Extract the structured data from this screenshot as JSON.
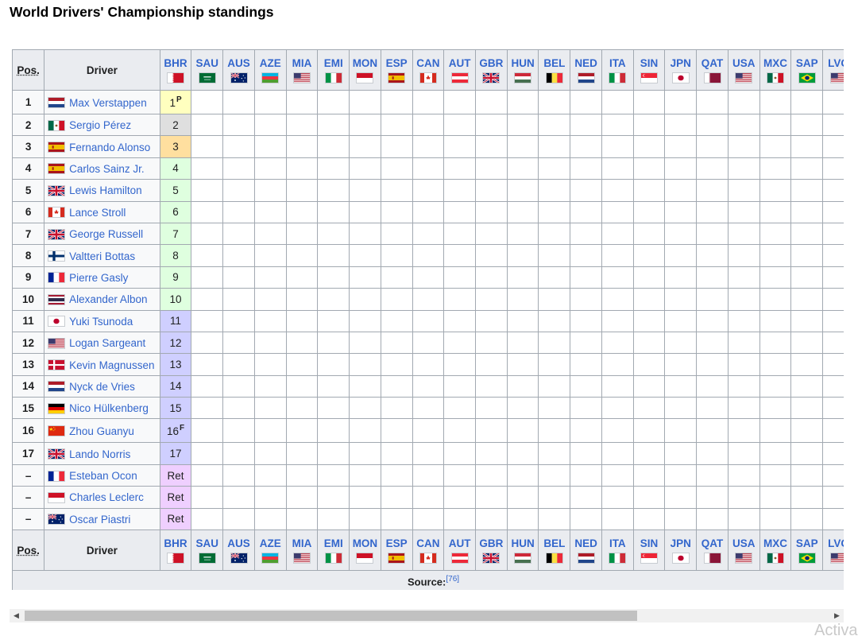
{
  "title": "World Drivers' Championship standings",
  "header": {
    "pos": "Pos.",
    "driver": "Driver"
  },
  "races": [
    {
      "code": "BHR",
      "flag": "bahrain"
    },
    {
      "code": "SAU",
      "flag": "saudi"
    },
    {
      "code": "AUS",
      "flag": "australia"
    },
    {
      "code": "AZE",
      "flag": "azerbaijan"
    },
    {
      "code": "MIA",
      "flag": "usa"
    },
    {
      "code": "EMI",
      "flag": "italy"
    },
    {
      "code": "MON",
      "flag": "monaco"
    },
    {
      "code": "ESP",
      "flag": "spain"
    },
    {
      "code": "CAN",
      "flag": "canada"
    },
    {
      "code": "AUT",
      "flag": "austria"
    },
    {
      "code": "GBR",
      "flag": "uk"
    },
    {
      "code": "HUN",
      "flag": "hungary"
    },
    {
      "code": "BEL",
      "flag": "belgium"
    },
    {
      "code": "NED",
      "flag": "netherlands"
    },
    {
      "code": "ITA",
      "flag": "italy"
    },
    {
      "code": "SIN",
      "flag": "singapore"
    },
    {
      "code": "JPN",
      "flag": "japan"
    },
    {
      "code": "QAT",
      "flag": "qatar"
    },
    {
      "code": "USA",
      "flag": "usa"
    },
    {
      "code": "MXC",
      "flag": "mexico"
    },
    {
      "code": "SAP",
      "flag": "brazil"
    },
    {
      "code": "LVG",
      "flag": "usa"
    }
  ],
  "rows": [
    {
      "pos": "1",
      "driver": "Max Verstappen",
      "flag": "netherlands",
      "result": "1",
      "sup": "P",
      "cls": "c-gold"
    },
    {
      "pos": "2",
      "driver": "Sergio Pérez",
      "flag": "mexico",
      "result": "2",
      "sup": "",
      "cls": "c-silver"
    },
    {
      "pos": "3",
      "driver": "Fernando Alonso",
      "flag": "spain",
      "result": "3",
      "sup": "",
      "cls": "c-bronze"
    },
    {
      "pos": "4",
      "driver": "Carlos Sainz Jr.",
      "flag": "spain",
      "result": "4",
      "sup": "",
      "cls": "c-green"
    },
    {
      "pos": "5",
      "driver": "Lewis Hamilton",
      "flag": "uk",
      "result": "5",
      "sup": "",
      "cls": "c-green"
    },
    {
      "pos": "6",
      "driver": "Lance Stroll",
      "flag": "canada",
      "result": "6",
      "sup": "",
      "cls": "c-green"
    },
    {
      "pos": "7",
      "driver": "George Russell",
      "flag": "uk",
      "result": "7",
      "sup": "",
      "cls": "c-green"
    },
    {
      "pos": "8",
      "driver": "Valtteri Bottas",
      "flag": "finland",
      "result": "8",
      "sup": "",
      "cls": "c-green"
    },
    {
      "pos": "9",
      "driver": "Pierre Gasly",
      "flag": "france",
      "result": "9",
      "sup": "",
      "cls": "c-green"
    },
    {
      "pos": "10",
      "driver": "Alexander Albon",
      "flag": "thailand",
      "result": "10",
      "sup": "",
      "cls": "c-green"
    },
    {
      "pos": "11",
      "driver": "Yuki Tsunoda",
      "flag": "japan",
      "result": "11",
      "sup": "",
      "cls": "c-blue"
    },
    {
      "pos": "12",
      "driver": "Logan Sargeant",
      "flag": "usa",
      "result": "12",
      "sup": "",
      "cls": "c-blue"
    },
    {
      "pos": "13",
      "driver": "Kevin Magnussen",
      "flag": "denmark",
      "result": "13",
      "sup": "",
      "cls": "c-blue"
    },
    {
      "pos": "14",
      "driver": "Nyck de Vries",
      "flag": "netherlands",
      "result": "14",
      "sup": "",
      "cls": "c-blue"
    },
    {
      "pos": "15",
      "driver": "Nico Hülkenberg",
      "flag": "germany",
      "result": "15",
      "sup": "",
      "cls": "c-blue"
    },
    {
      "pos": "16",
      "driver": "Zhou Guanyu",
      "flag": "china",
      "result": "16",
      "sup": "F",
      "cls": "c-blue"
    },
    {
      "pos": "17",
      "driver": "Lando Norris",
      "flag": "uk",
      "result": "17",
      "sup": "",
      "cls": "c-blue"
    },
    {
      "pos": "–",
      "driver": "Esteban Ocon",
      "flag": "france",
      "result": "Ret",
      "sup": "",
      "cls": "c-ret"
    },
    {
      "pos": "–",
      "driver": "Charles Leclerc",
      "flag": "monaco",
      "result": "Ret",
      "sup": "",
      "cls": "c-ret"
    },
    {
      "pos": "–",
      "driver": "Oscar Piastri",
      "flag": "australia",
      "result": "Ret",
      "sup": "",
      "cls": "c-ret"
    }
  ],
  "source": {
    "label": "Source:",
    "ref": "[76]"
  },
  "watermark": "Activa",
  "colors": {
    "link": "#3366cc",
    "header_bg": "#eaecf0",
    "border": "#a2a9b1",
    "gold": "#ffffbf",
    "silver": "#dfdfdf",
    "bronze": "#ffdf9f",
    "points": "#dfffdf",
    "no_points": "#cfcfff",
    "retired": "#efcfff"
  }
}
